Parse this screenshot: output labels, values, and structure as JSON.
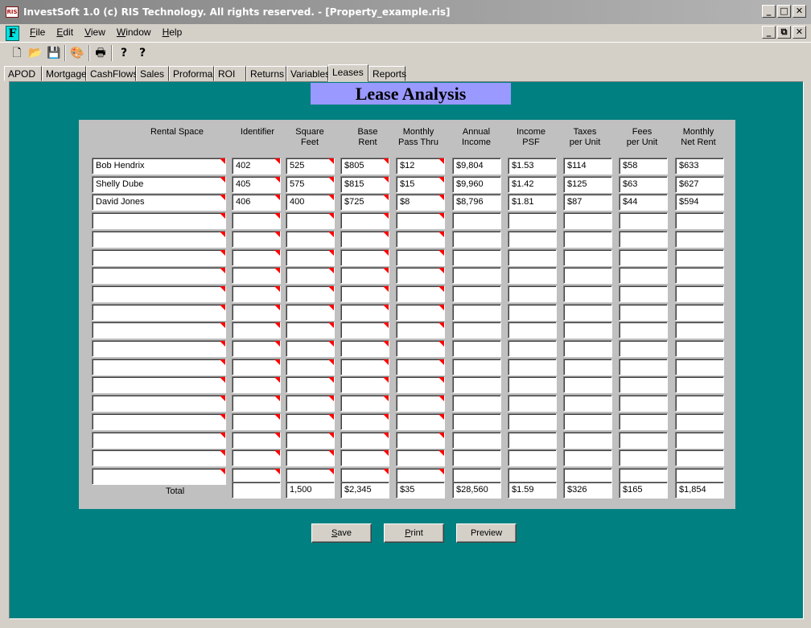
{
  "window": {
    "icon_text": "RIS",
    "title": "InvestSoft 1.0 (c) RIS Technology. All rights reserved. - [Property_example.ris]",
    "min": "_",
    "max": "□",
    "close": "✕"
  },
  "menubar": {
    "app_icon": "F",
    "items": [
      {
        "label": "File",
        "accel": "F",
        "rest": "ile"
      },
      {
        "label": "Edit",
        "accel": "E",
        "rest": "dit"
      },
      {
        "label": "View",
        "accel": "V",
        "rest": "iew"
      },
      {
        "label": "Window",
        "accel": "W",
        "rest": "indow"
      },
      {
        "label": "Help",
        "accel": "H",
        "rest": "elp"
      }
    ],
    "mdi_min": "_",
    "mdi_restore": "⧉",
    "mdi_close": "✕"
  },
  "toolbar": {
    "new_icon": "🗋",
    "open_icon": "📂",
    "save_icon": "💾",
    "color_icon": "🎨",
    "print_icon": "🖶",
    "help_icon": "?",
    "context_help_icon": "?"
  },
  "tabs": [
    "APOD",
    "Mortgage",
    "CashFlows",
    "Sales",
    "Proforma",
    "ROI",
    "Returns",
    "Variables",
    "Leases",
    "Reports"
  ],
  "active_tab": "Leases",
  "page": {
    "heading": "Lease Analysis"
  },
  "table": {
    "headers": [
      [
        "Rental Space",
        ""
      ],
      [
        "Identifier",
        ""
      ],
      [
        "Square",
        "Feet"
      ],
      [
        "Base",
        "Rent"
      ],
      [
        "Monthly",
        "Pass Thru"
      ],
      [
        "Annual",
        "Income"
      ],
      [
        "Income",
        "PSF"
      ],
      [
        "Taxes",
        "per Unit"
      ],
      [
        "Fees",
        "per Unit"
      ],
      [
        "Monthly",
        "Net Rent"
      ]
    ],
    "rows": [
      [
        "Bob Hendrix",
        "402",
        "525",
        "$805",
        "$12",
        "$9,804",
        "$1.53",
        "$114",
        "$58",
        "$633"
      ],
      [
        "Shelly Dube",
        "405",
        "575",
        "$815",
        "$15",
        "$9,960",
        "$1.42",
        "$125",
        "$63",
        "$627"
      ],
      [
        "David Jones",
        "406",
        "400",
        "$725",
        "$8",
        "$8,796",
        "$1.81",
        "$87",
        "$44",
        "$594"
      ],
      [
        "",
        "",
        "",
        "",
        "",
        "",
        "",
        "",
        "",
        ""
      ],
      [
        "",
        "",
        "",
        "",
        "",
        "",
        "",
        "",
        "",
        ""
      ],
      [
        "",
        "",
        "",
        "",
        "",
        "",
        "",
        "",
        "",
        ""
      ],
      [
        "",
        "",
        "",
        "",
        "",
        "",
        "",
        "",
        "",
        ""
      ],
      [
        "",
        "",
        "",
        "",
        "",
        "",
        "",
        "",
        "",
        ""
      ],
      [
        "",
        "",
        "",
        "",
        "",
        "",
        "",
        "",
        "",
        ""
      ],
      [
        "",
        "",
        "",
        "",
        "",
        "",
        "",
        "",
        "",
        ""
      ],
      [
        "",
        "",
        "",
        "",
        "",
        "",
        "",
        "",
        "",
        ""
      ],
      [
        "",
        "",
        "",
        "",
        "",
        "",
        "",
        "",
        "",
        ""
      ],
      [
        "",
        "",
        "",
        "",
        "",
        "",
        "",
        "",
        "",
        ""
      ],
      [
        "",
        "",
        "",
        "",
        "",
        "",
        "",
        "",
        "",
        ""
      ],
      [
        "",
        "",
        "",
        "",
        "",
        "",
        "",
        "",
        "",
        ""
      ],
      [
        "",
        "",
        "",
        "",
        "",
        "",
        "",
        "",
        "",
        ""
      ],
      [
        "",
        "",
        "",
        "",
        "",
        "",
        "",
        "",
        "",
        ""
      ],
      [
        "",
        "",
        "",
        "",
        "",
        "",
        "",
        "",
        "",
        ""
      ]
    ],
    "total_label": "Total",
    "totals": [
      "",
      "1,500",
      "$2,345",
      "$35",
      "$28,560",
      "$1.59",
      "$326",
      "$165",
      "$1,854"
    ]
  },
  "buttons": [
    {
      "label": "Save",
      "accel": "S",
      "rest": "ave"
    },
    {
      "label": "Print",
      "accel": "P",
      "rest": "rint"
    },
    {
      "label": "Preview",
      "accel": "",
      "rest": "Preview"
    }
  ],
  "colors": {
    "background": "#008080",
    "heading_bg": "#9999ff",
    "panel": "#c0c0c0",
    "flag": "#ff0000"
  }
}
